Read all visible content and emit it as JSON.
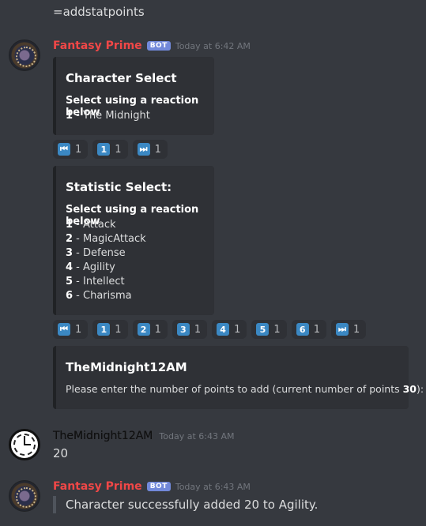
{
  "command": "=addstatpoints",
  "msg1": {
    "author": "Fantasy Prime",
    "badge": "BOT",
    "timestamp": "Today at 6:42 AM",
    "embed1": {
      "title": "Character Select",
      "subtitle": "Select using a reaction below",
      "items": [
        {
          "num": "1",
          "text": " - The Midnight"
        }
      ]
    },
    "reactions1": [
      {
        "icon": "⏮",
        "count": "1"
      },
      {
        "icon": "1",
        "count": "1"
      },
      {
        "icon": "⏭",
        "count": "1"
      }
    ],
    "embed2": {
      "title": "Statistic Select:",
      "subtitle": "Select using a reaction below",
      "items": [
        {
          "num": "1",
          "text": " - Attack"
        },
        {
          "num": "2",
          "text": " - MagicAttack"
        },
        {
          "num": "3",
          "text": " - Defense"
        },
        {
          "num": "4",
          "text": " - Agility"
        },
        {
          "num": "5",
          "text": " - Intellect"
        },
        {
          "num": "6",
          "text": " - Charisma"
        }
      ]
    },
    "reactions2": [
      {
        "icon": "⏮",
        "count": "1"
      },
      {
        "icon": "1",
        "count": "1"
      },
      {
        "icon": "2",
        "count": "1"
      },
      {
        "icon": "3",
        "count": "1"
      },
      {
        "icon": "4",
        "count": "1"
      },
      {
        "icon": "5",
        "count": "1"
      },
      {
        "icon": "6",
        "count": "1"
      },
      {
        "icon": "⏭",
        "count": "1"
      }
    ],
    "embed3": {
      "title": "TheMidnight12AM",
      "text_before": "Please enter the number of points to add (current number of points ",
      "points": "30",
      "text_after": "):"
    }
  },
  "msg2": {
    "author": "TheMidnight12AM",
    "timestamp": "Today at 6:43 AM",
    "text": "20"
  },
  "msg3": {
    "author": "Fantasy Prime",
    "badge": "BOT",
    "timestamp": "Today at 6:43 AM",
    "quote": "Character successfully added 20 to Agility."
  },
  "colors": {
    "background": "#36393f",
    "embed": "#2f3136",
    "bot_name": "#f04747",
    "badge": "#7289da",
    "keycap": "#3b88c3"
  }
}
